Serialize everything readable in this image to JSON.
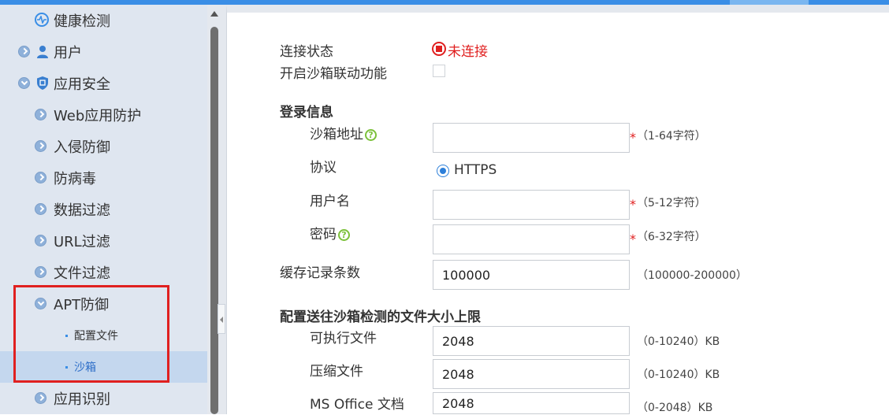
{
  "sidebar": {
    "items": [
      {
        "label": "健康检测"
      },
      {
        "label": "用户"
      },
      {
        "label": "应用安全"
      },
      {
        "label": "Web应用防护"
      },
      {
        "label": "入侵防御"
      },
      {
        "label": "防病毒"
      },
      {
        "label": "数据过滤"
      },
      {
        "label": "URL过滤"
      },
      {
        "label": "文件过滤"
      },
      {
        "label": "APT防御"
      },
      {
        "label": "配置文件"
      },
      {
        "label": "沙箱"
      },
      {
        "label": "应用识别"
      }
    ],
    "selected": "沙箱"
  },
  "form": {
    "connection_status_label": "连接状态",
    "connection_status_value": "未连接",
    "sandbox_link_label": "开启沙箱联动功能",
    "login_section": "登录信息",
    "address_label": "沙箱地址",
    "address_value": "",
    "address_hint": "（1-64字符）",
    "protocol_label": "协议",
    "protocol_value": "HTTPS",
    "username_label": "用户名",
    "username_value": "",
    "username_hint": "（5-12字符）",
    "password_label": "密码",
    "password_value": "",
    "password_hint": "（6-32字符）",
    "cache_label": "缓存记录条数",
    "cache_value": "100000",
    "cache_hint": "（100000-200000）",
    "filesize_section": "配置送往沙箱检测的文件大小上限",
    "exe_label": "可执行文件",
    "exe_value": "2048",
    "exe_hint": "（0-10240）KB",
    "zip_label": "压缩文件",
    "zip_value": "2048",
    "zip_hint": "（0-10240）KB",
    "office_label": "MS Office 文档",
    "office_value": "2048",
    "office_hint": "（0-2048）KB",
    "required_mark": "*",
    "help_glyph": "?"
  },
  "colors": {
    "accent": "#3a8ee6",
    "sidebar_bg": "#dfe6f0",
    "selected_bg": "#c4d7ee",
    "error": "#e02020",
    "help": "#7cc13b",
    "highlight_box": "#e02020"
  }
}
